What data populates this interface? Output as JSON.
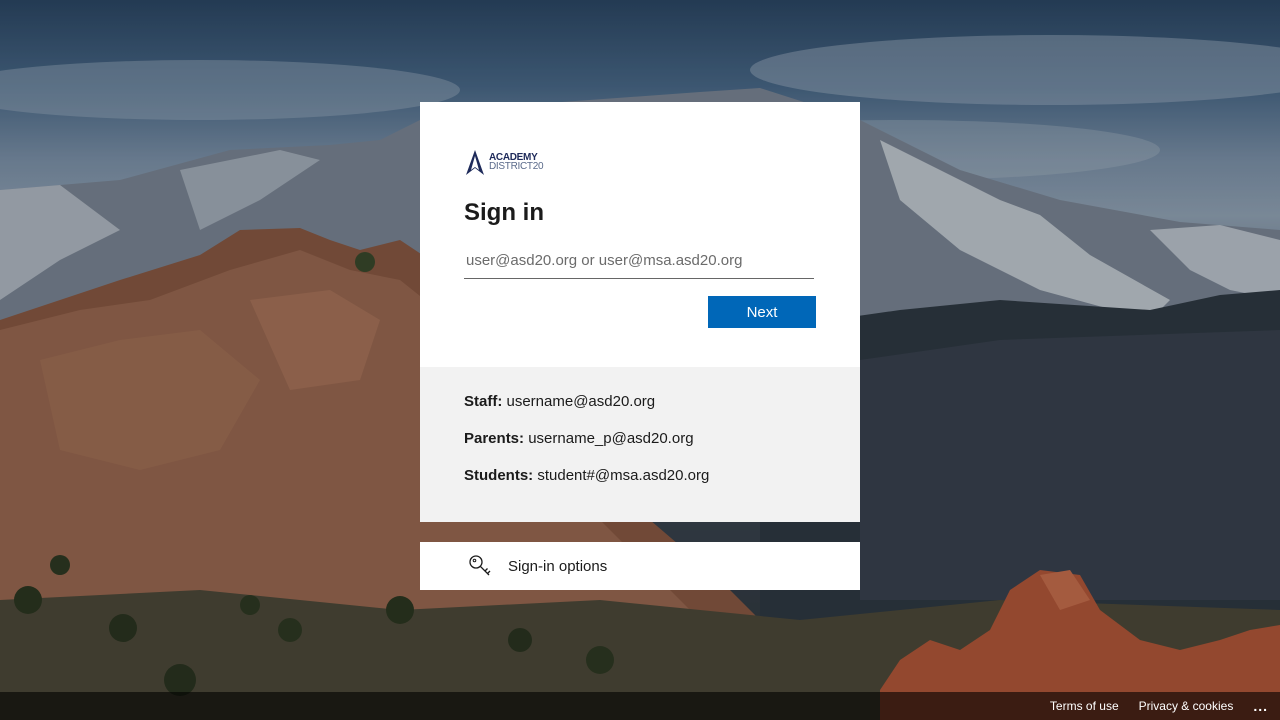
{
  "brand": {
    "logo_line1": "ACADEMY",
    "logo_line2": "DISTRICT20",
    "logo_color": "#1e2a5a"
  },
  "signin": {
    "title": "Sign in",
    "email_placeholder": "user@asd20.org or user@msa.asd20.org",
    "email_value": "",
    "next_label": "Next",
    "accent_color": "#0067b8"
  },
  "info": {
    "staff_label": "Staff:",
    "staff_value": "username@asd20.org",
    "parents_label": "Parents:",
    "parents_value": "username_p@asd20.org",
    "students_label": "Students:",
    "students_value": "student#@msa.asd20.org"
  },
  "options": {
    "label": "Sign-in options",
    "icon": "key-icon"
  },
  "footer": {
    "terms_label": "Terms of use",
    "privacy_label": "Privacy & cookies",
    "more_label": "..."
  }
}
